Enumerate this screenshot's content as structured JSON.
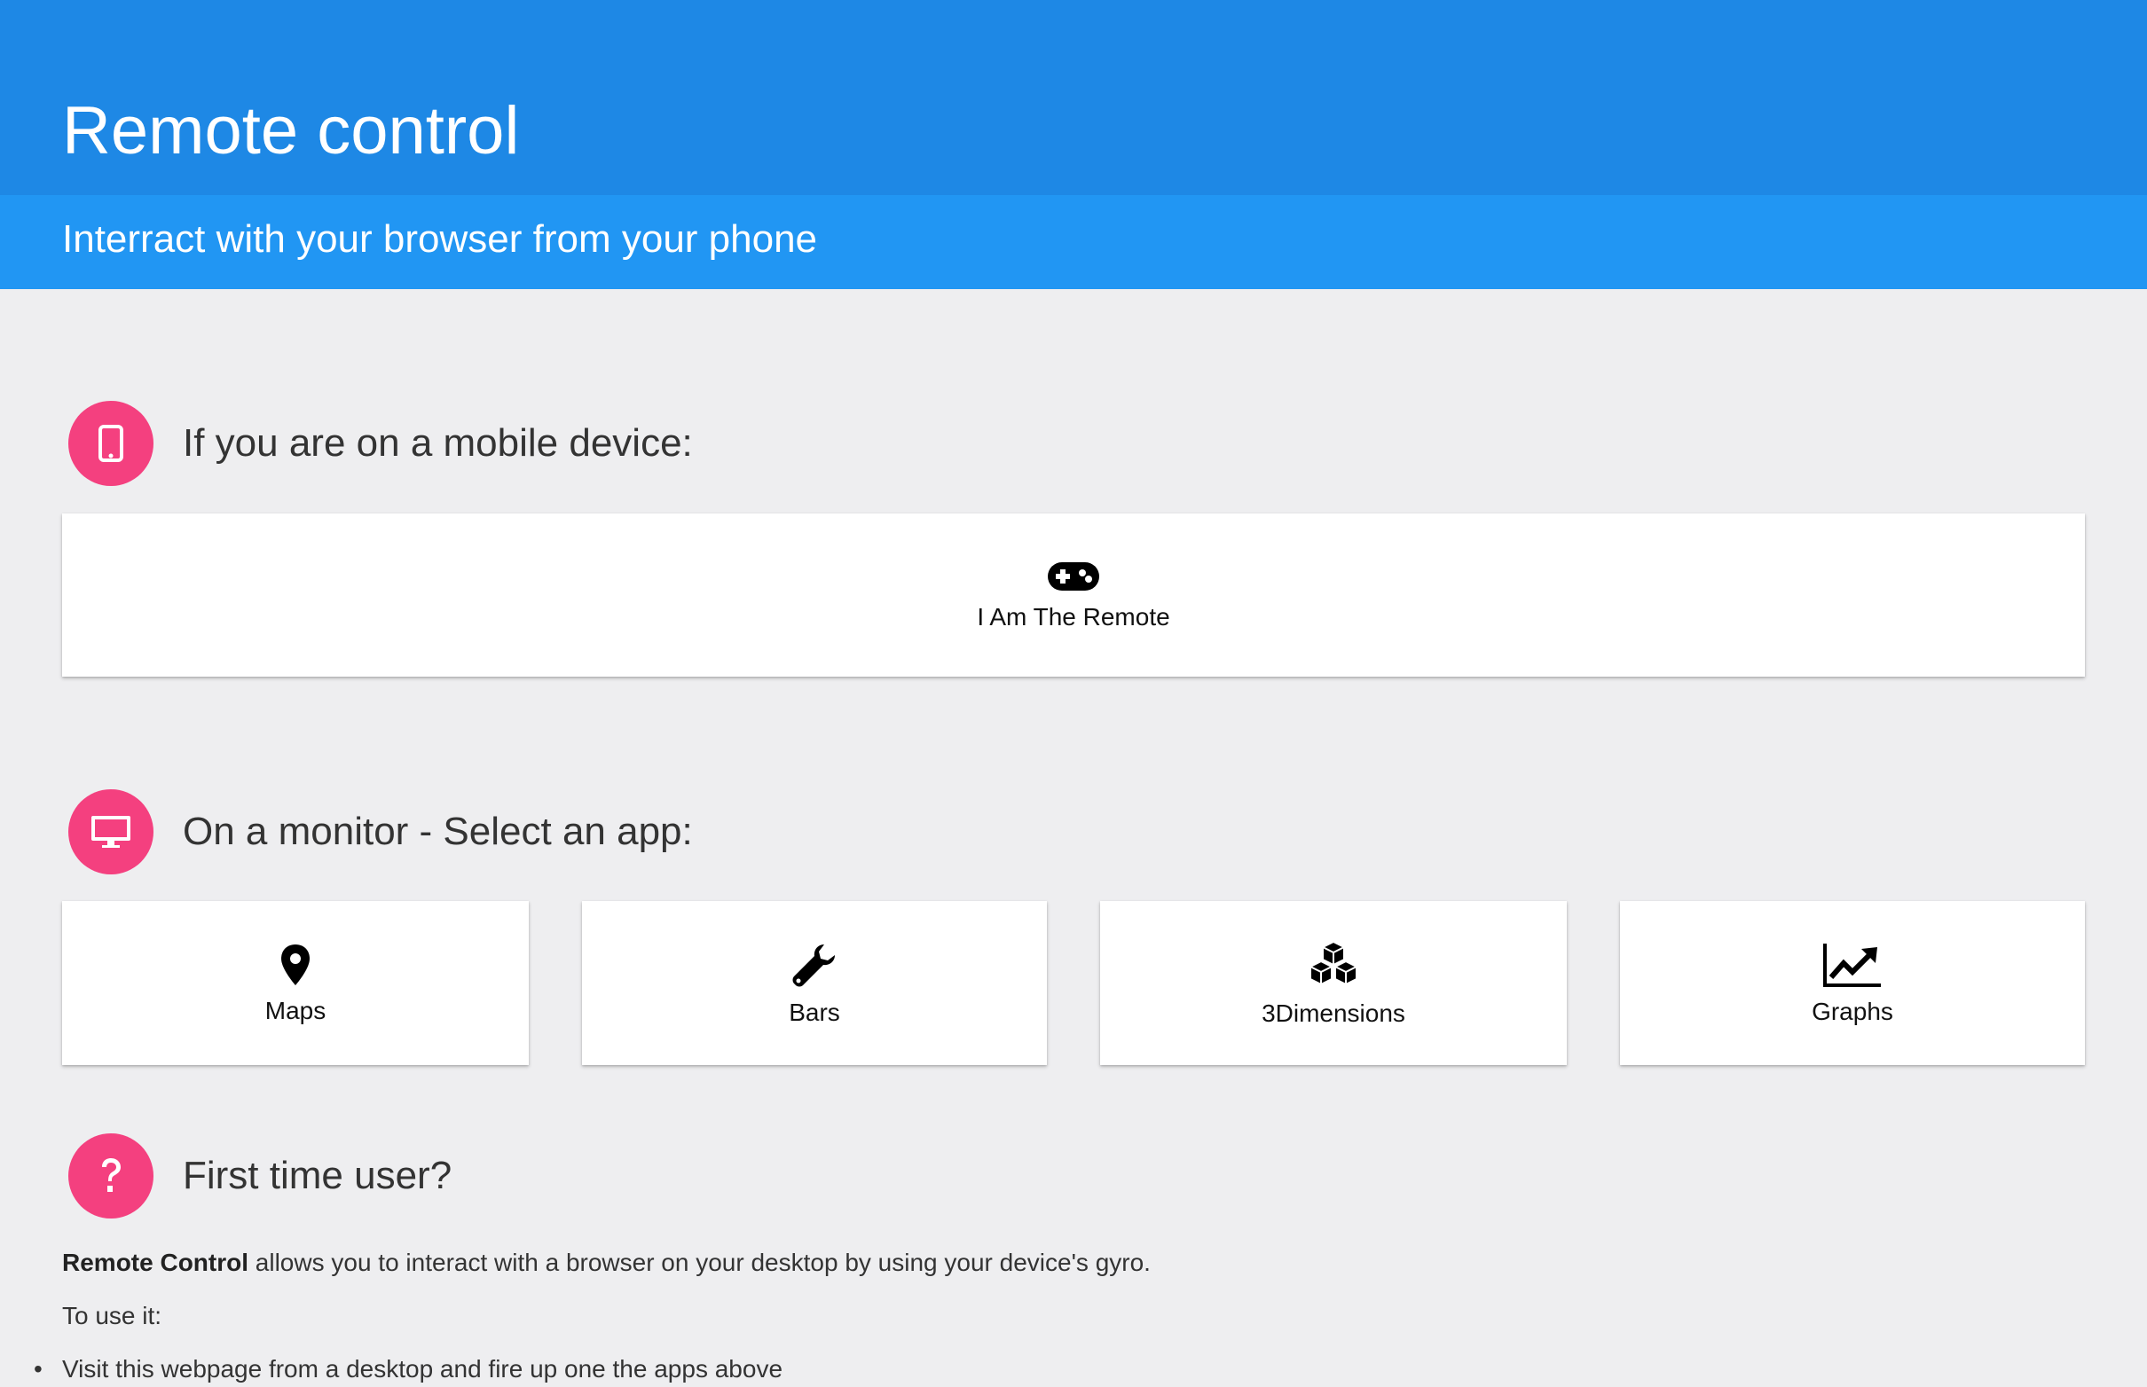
{
  "header": {
    "title": "Remote control",
    "subtitle": "Interract with your browser from your phone"
  },
  "sections": {
    "mobile": {
      "icon": "mobile-phone-icon",
      "heading": "If you are on a mobile device:",
      "remote_button": {
        "icon": "gamepad-icon",
        "label": "I Am The Remote"
      }
    },
    "monitor": {
      "icon": "monitor-icon",
      "heading": "On a monitor - Select an app:",
      "apps": [
        {
          "icon": "map-pin-icon",
          "label": "Maps"
        },
        {
          "icon": "wrench-icon",
          "label": "Bars"
        },
        {
          "icon": "cubes-icon",
          "label": "3Dimensions"
        },
        {
          "icon": "line-chart-icon",
          "label": "Graphs"
        }
      ]
    },
    "first_time": {
      "icon": "question-icon",
      "heading": "First time user?",
      "intro_bold": "Remote Control",
      "intro_rest": " allows you to interact with a browser on your desktop by using your device's gyro.",
      "to_use": "To use it:",
      "steps": [
        "Visit this webpage from a desktop and fire up one the apps above"
      ]
    }
  },
  "colors": {
    "header_top": "#1e88e5",
    "header_sub": "#2196f3",
    "accent_circle": "#f4407f",
    "background": "#eeeef0"
  }
}
